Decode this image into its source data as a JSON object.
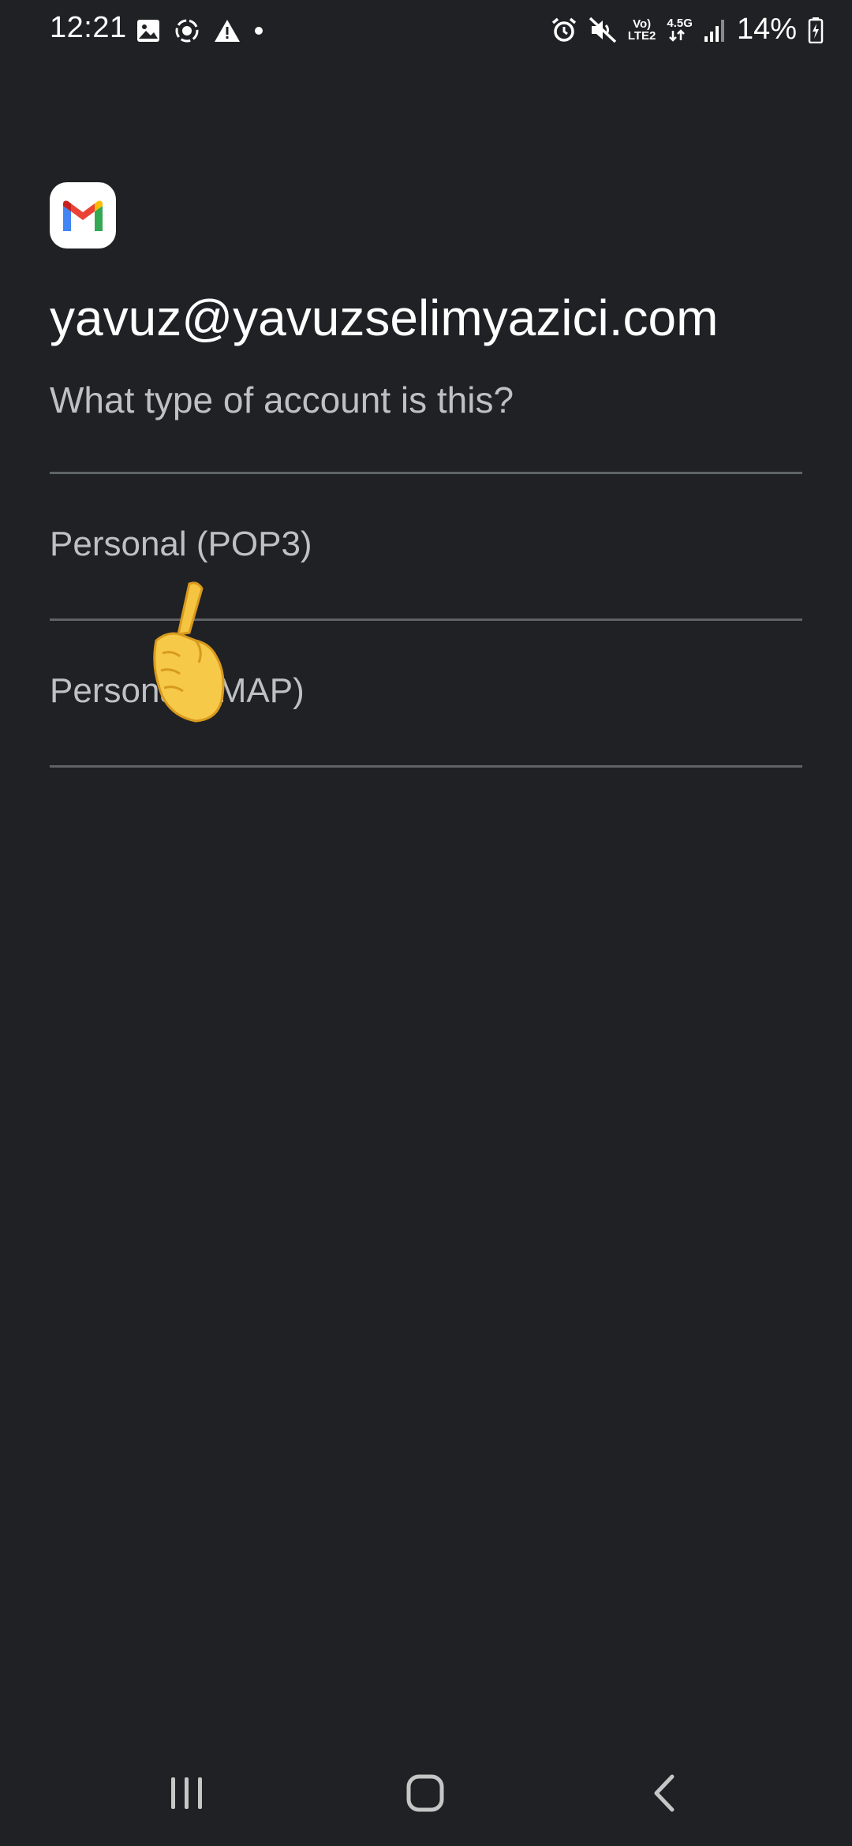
{
  "status_bar": {
    "time": "12:21",
    "left_icons": [
      "image-icon",
      "screen-record-icon",
      "warning-icon",
      "dot-icon"
    ],
    "right_icons": [
      "alarm-icon",
      "mute-icon",
      "volte-icon",
      "network-4-5g-icon",
      "signal-icon",
      "battery-icon"
    ],
    "volte_top": "Vo)",
    "volte_bottom": "LTE2",
    "network_type": "4.5G",
    "battery": "14%"
  },
  "app": {
    "logo": "gmail-logo",
    "account_email": "yavuz@yavuzselimyazici.com",
    "question": "What type of account is this?",
    "options": [
      {
        "label": "Personal (POP3)"
      },
      {
        "label": "Personal (IMAP)"
      }
    ]
  },
  "overlay": {
    "pointer": "pointing-hand-icon"
  },
  "nav_bar": {
    "buttons": [
      "recents-icon",
      "home-icon",
      "back-icon"
    ]
  },
  "colors": {
    "background": "#202124",
    "text_primary": "#ffffff",
    "text_secondary": "#bdc1c6",
    "divider": "#5f6368"
  }
}
